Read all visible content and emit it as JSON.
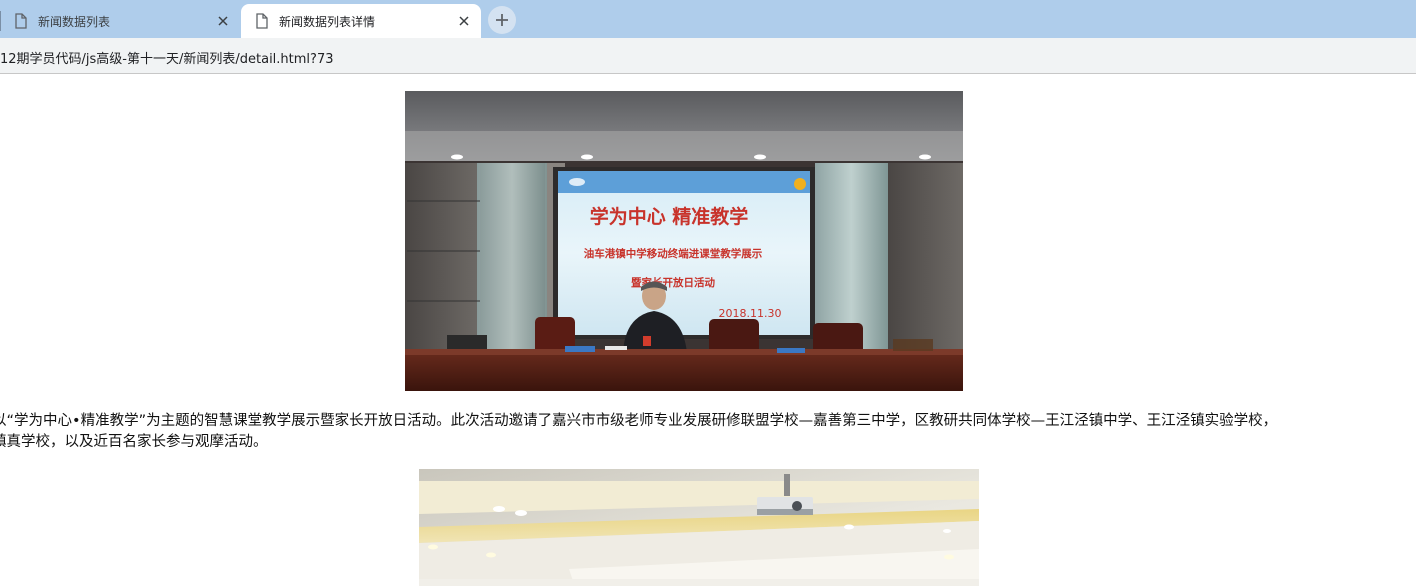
{
  "tabs": [
    {
      "title": "新闻数据列表",
      "active": false,
      "icon": "document-icon"
    },
    {
      "title": "新闻数据列表详情",
      "active": true,
      "icon": "document-icon"
    }
  ],
  "new_tab_icon": "plus-icon",
  "address_bar": {
    "url": "12期学员代码/js高级-第十一天/新闻列表/detail.html?73"
  },
  "article": {
    "photo1": {
      "banner_title": "学为中心  精准教学",
      "banner_subtitle1": "油车港镇中学移动终端进课堂教学展示",
      "banner_subtitle2": "暨家长开放日活动",
      "banner_date": "2018.11.30"
    },
    "paragraph_line1": "以“学为中心•精准教学”为主题的智慧课堂教学展示暨家长开放日活动。此次活动邀请了嘉兴市市级老师专业发展研修联盟学校—嘉善第三中学，区教研共同体学校—王江泾镇中学、王江泾镇实验学校，",
    "paragraph_line2": "镇真学校，以及近百名家长参与观摩活动。"
  },
  "colors": {
    "tabstrip": "#afcdeb",
    "toolbar": "#f1f3f4",
    "banner_text": "#c8332b"
  }
}
